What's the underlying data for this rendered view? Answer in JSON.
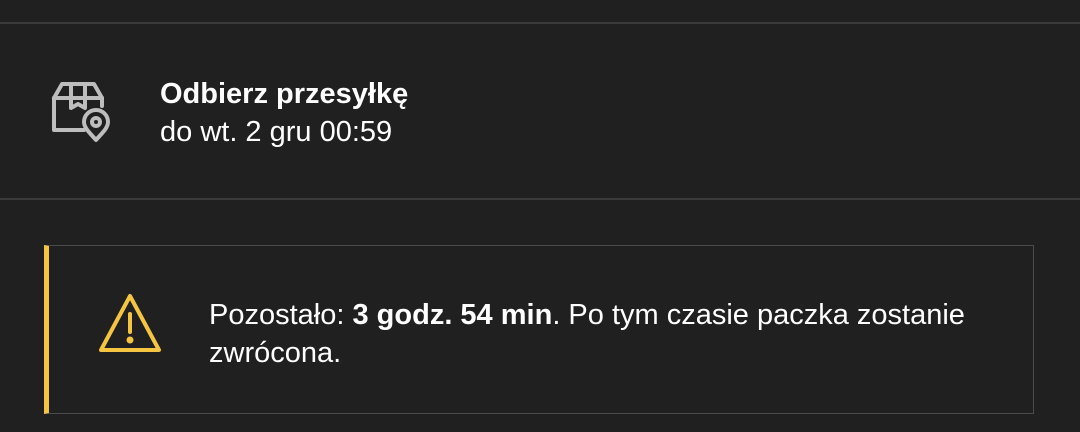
{
  "pickup": {
    "icon": "package-location-icon",
    "title": "Odbierz przesyłkę",
    "deadline": "do wt. 2 gru 00:59"
  },
  "warning": {
    "icon": "warning-triangle-icon",
    "accent_color": "#f5c542",
    "prefix": "Pozostało: ",
    "remaining_time": "3 godz. 54 min",
    "suffix": ". Po tym czasie paczka zostanie zwrócona."
  }
}
